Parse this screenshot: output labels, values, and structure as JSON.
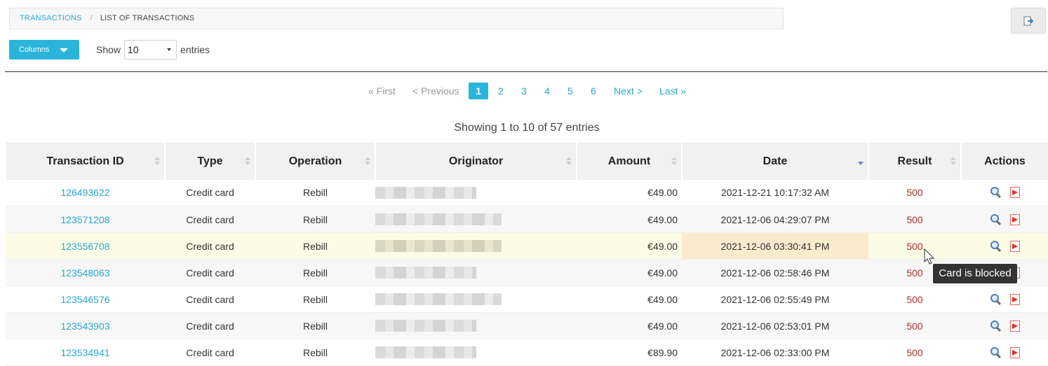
{
  "breadcrumb": {
    "link": "TRANSACTIONS",
    "separator": "/",
    "current": "LIST OF TRANSACTIONS"
  },
  "toolbar": {
    "columns_label": "Columns",
    "show_label": "Show",
    "entries_value": "10",
    "entries_label": "entries"
  },
  "pagination": {
    "first": "« First",
    "previous": "< Previous",
    "pages": [
      "1",
      "2",
      "3",
      "4",
      "5",
      "6"
    ],
    "current_page": "1",
    "next": "Next >",
    "last": "Last »"
  },
  "info": "Showing 1 to 10 of 57 entries",
  "table": {
    "columns": [
      "Transaction ID",
      "Type",
      "Operation",
      "Originator",
      "Amount",
      "Date",
      "Result",
      "Actions"
    ],
    "sorted_column": "Date",
    "sort_direction": "desc",
    "rows": [
      {
        "id": "126493622",
        "type": "Credit card",
        "operation": "Rebill",
        "amount": "€49.00",
        "date": "2021-12-21 10:17:32 AM",
        "result": "500"
      },
      {
        "id": "123571208",
        "type": "Credit card",
        "operation": "Rebill",
        "amount": "€49.00",
        "date": "2021-12-06 04:29:07 PM",
        "result": "500"
      },
      {
        "id": "123556708",
        "type": "Credit card",
        "operation": "Rebill",
        "amount": "€49.00",
        "date": "2021-12-06 03:30:41 PM",
        "result": "500"
      },
      {
        "id": "123548063",
        "type": "Credit card",
        "operation": "Rebill",
        "amount": "€49.00",
        "date": "2021-12-06 02:58:46 PM",
        "result": "500"
      },
      {
        "id": "123546576",
        "type": "Credit card",
        "operation": "Rebill",
        "amount": "€49.00",
        "date": "2021-12-06 02:55:49 PM",
        "result": "500"
      },
      {
        "id": "123543903",
        "type": "Credit card",
        "operation": "Rebill",
        "amount": "€49.00",
        "date": "2021-12-06 02:53:01 PM",
        "result": "500"
      },
      {
        "id": "123534941",
        "type": "Credit card",
        "operation": "Rebill",
        "amount": "€89.90",
        "date": "2021-12-06 02:33:00 PM",
        "result": "500"
      }
    ]
  },
  "tooltip": "Card is blocked",
  "colors": {
    "accent": "#29b6dc",
    "link": "#29a8d6",
    "result": "#b03030",
    "hover_row": "#fcfce6",
    "hover_cell": "#fbebcd"
  },
  "icons": {
    "view": "magnifier-icon",
    "pdf": "pdf-icon",
    "export": "export-icon"
  }
}
